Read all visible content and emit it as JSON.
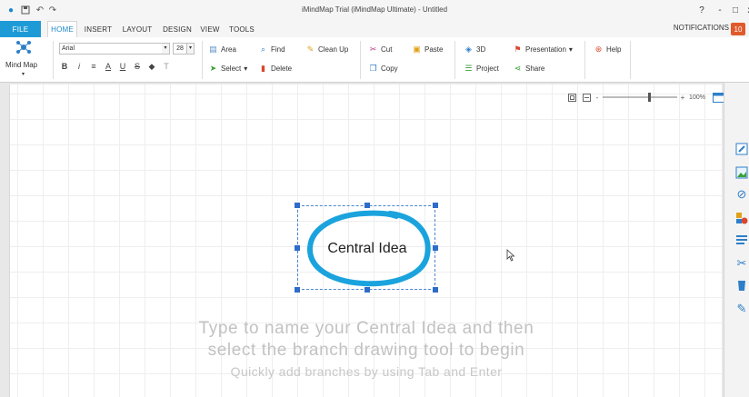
{
  "app": {
    "title": "iMindMap Trial (iMindMap Ultimate) - Untitled"
  },
  "quick_access": [
    "logo-icon",
    "save-icon",
    "undo-icon",
    "redo-icon"
  ],
  "window_controls": {
    "help": "?",
    "minimize": "-",
    "maximize": "□",
    "close": "x"
  },
  "tabs": [
    "FILE",
    "HOME",
    "INSERT",
    "LAYOUT",
    "DESIGN",
    "VIEW",
    "TOOLS"
  ],
  "notifications": {
    "label": "NOTIFICATIONS",
    "count": "10"
  },
  "ribbon": {
    "mindmap_label": "Mind Map",
    "font_name": "Arial",
    "font_size": "28",
    "dropdown_glyph": "▾",
    "format_buttons": {
      "bold": "B",
      "italic": "i",
      "align": "≡",
      "text_color": "A",
      "underline": "U",
      "strike": "S",
      "fill": "◆",
      "clear": "T"
    },
    "area": "Area",
    "select": "Select",
    "find": "Find",
    "delete": "Delete",
    "clean_up": "Clean Up",
    "cut": "Cut",
    "copy": "Copy",
    "paste": "Paste",
    "view3d": "3D",
    "project": "Project",
    "presentation": "Presentation",
    "share": "Share",
    "help": "Help"
  },
  "zoom": {
    "level": "100%",
    "minus": "-",
    "plus": "+"
  },
  "canvas": {
    "central_idea": "Central Idea",
    "hint_line1": "Type to name your Central Idea and then",
    "hint_line2": "select the branch drawing tool to begin",
    "hint_line3": "Quickly add branches by using Tab and Enter"
  },
  "colors": {
    "accent": "#1e9bd7",
    "central_ring": "#1aa3dd",
    "selection": "#2f6cc9",
    "badge": "#e05a2b"
  },
  "right_panel_icons": [
    "edit-icon",
    "image-icon",
    "attach-icon",
    "shapes-icon",
    "list-icon",
    "tools-icon",
    "bucket-icon",
    "brush-icon"
  ]
}
